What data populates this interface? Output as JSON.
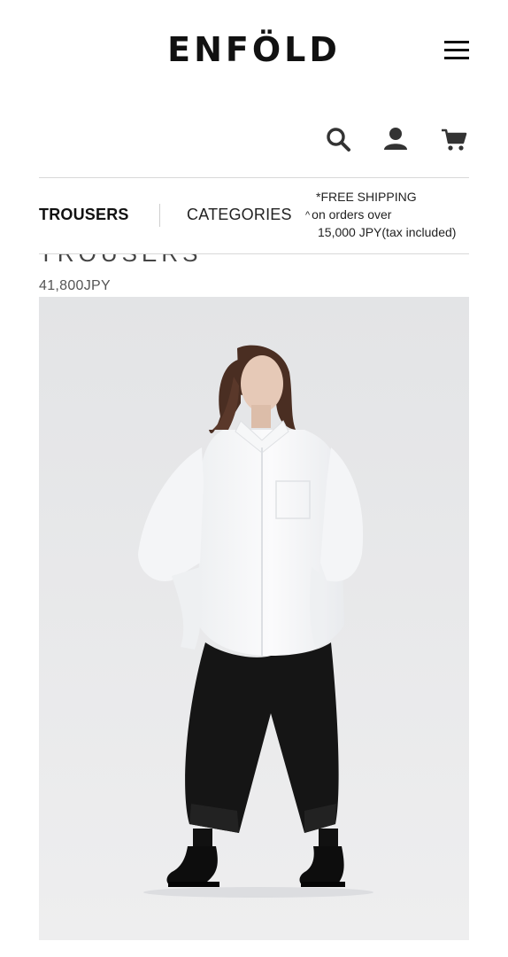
{
  "header": {
    "logo": "ENFÖLD",
    "icons": [
      "menu-icon",
      "search-icon",
      "account-icon",
      "cart-icon"
    ]
  },
  "nav": {
    "current": "TROUSERS",
    "categories_label": "CATEGORIES",
    "shipping": {
      "line1": "*FREE SHIPPING",
      "line2": "on orders over",
      "line3": "15,000 JPY(tax included)"
    }
  },
  "product": {
    "title": "TROUSERS",
    "price": "41,800JPY",
    "image_bg": "#e8e9eb"
  }
}
